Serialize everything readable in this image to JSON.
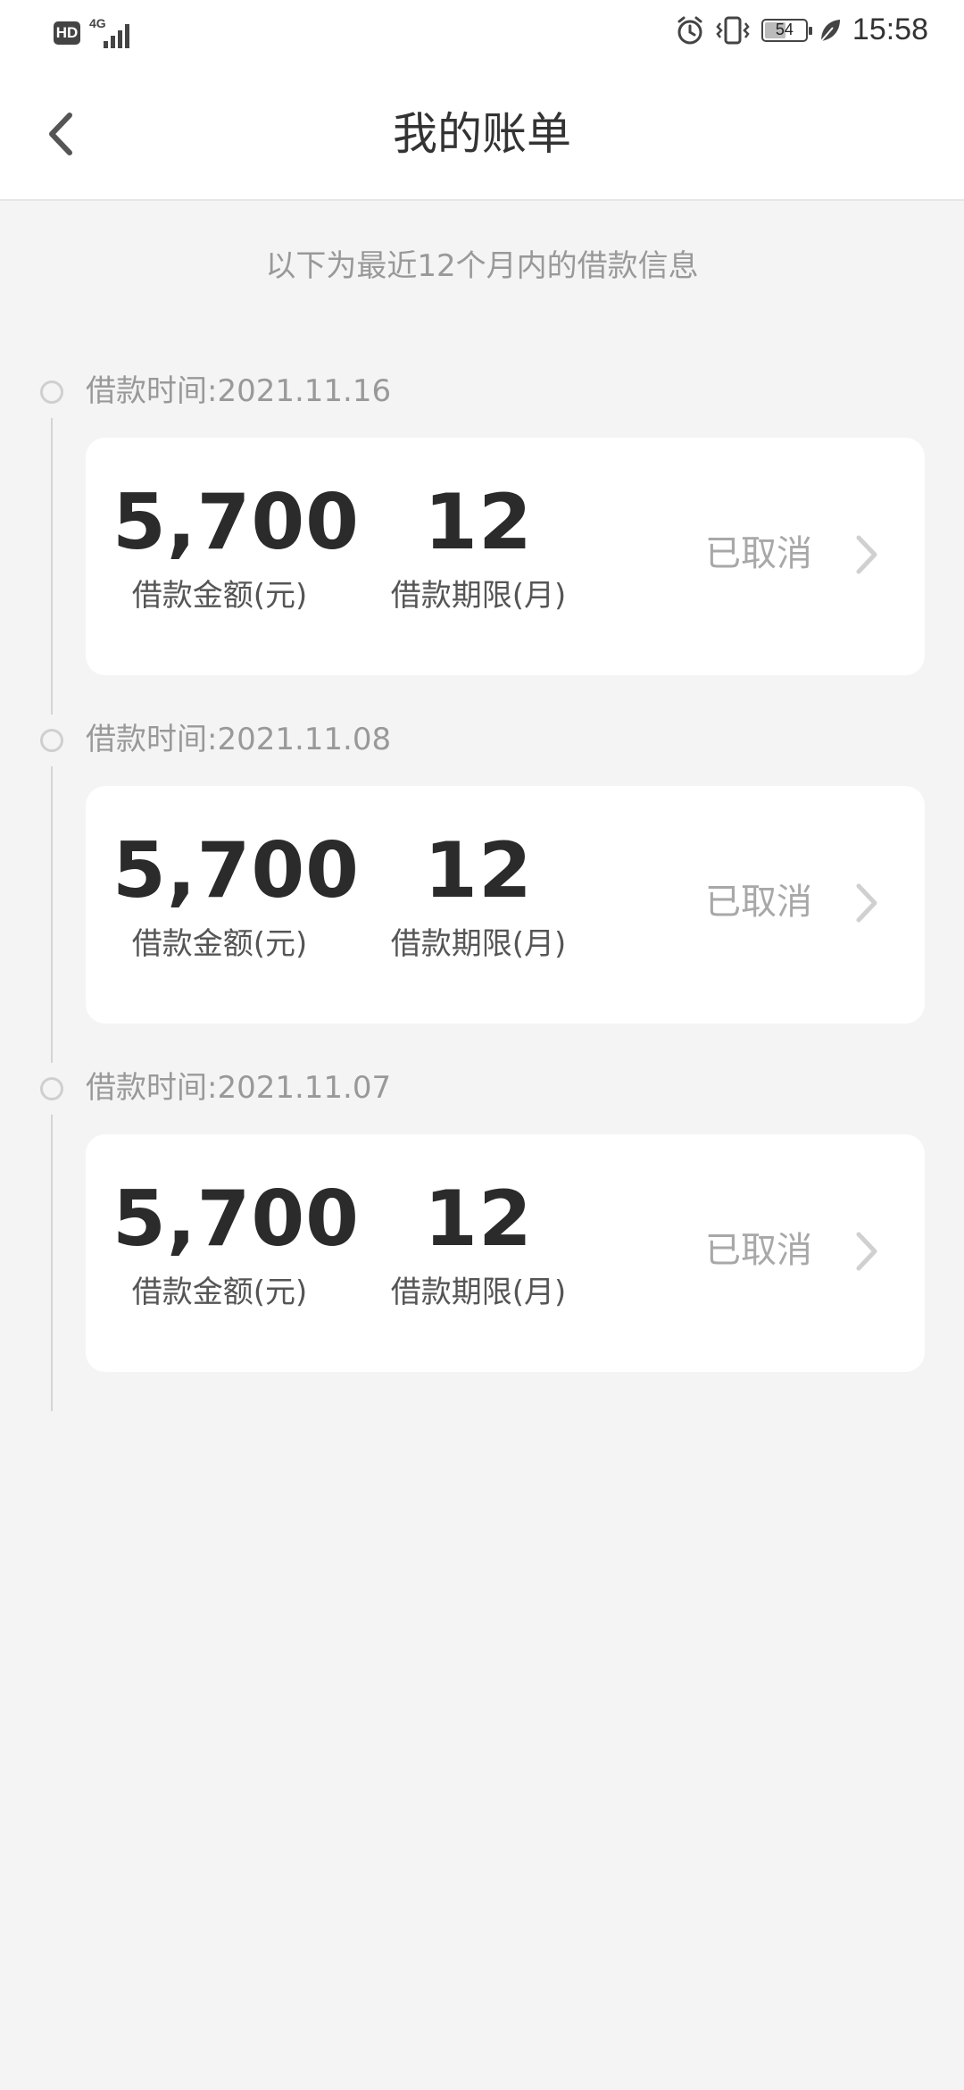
{
  "status_bar": {
    "hd": "HD",
    "network": "4G",
    "battery": "54",
    "battery_level": 0.54,
    "time": "15:58",
    "icons": [
      "alarm-icon",
      "vibrate-icon",
      "battery-icon",
      "leaf-icon"
    ]
  },
  "header": {
    "title": "我的账单",
    "back_icon": "chevron-left-icon"
  },
  "subtitle": "以下为最近12个月内的借款信息",
  "bills": [
    {
      "date_text": "借款时间:2021.11.16",
      "amount": "5,700",
      "amount_label": "借款金额(元)",
      "term": "12",
      "term_label": "借款期限(月)",
      "status": "已取消"
    },
    {
      "date_text": "借款时间:2021.11.08",
      "amount": "5,700",
      "amount_label": "借款金额(元)",
      "term": "12",
      "term_label": "借款期限(月)",
      "status": "已取消"
    },
    {
      "date_text": "借款时间:2021.11.07",
      "amount": "5,700",
      "amount_label": "借款金额(元)",
      "term": "12",
      "term_label": "借款期限(月)",
      "status": "已取消"
    }
  ],
  "colors": {
    "background": "#f4f4f4",
    "card": "#ffffff",
    "primary_text": "#2b2b2b",
    "muted_text": "#999999",
    "status_text": "#a8a8a8"
  }
}
